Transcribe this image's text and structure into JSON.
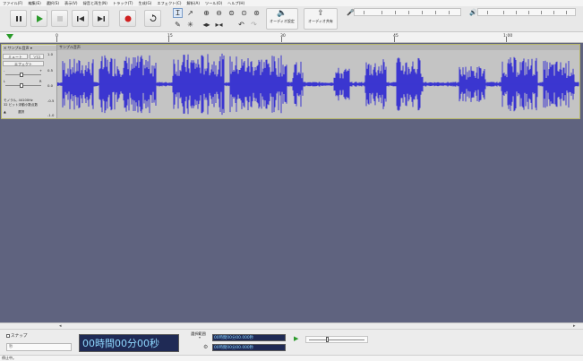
{
  "menu": [
    "ファイル(F)",
    "編集(E)",
    "選択(S)",
    "表示(V)",
    "録音と再生(N)",
    "トラック(T)",
    "生成(G)",
    "エフェクト(C)",
    "解析(A)",
    "ツール(O)",
    "ヘルプ(H)"
  ],
  "transport": {
    "pause_icon": "pause-icon",
    "play_icon": "play-icon",
    "stop_icon": "stop-icon",
    "skip_start_icon": "skip-to-start-icon",
    "skip_end_icon": "skip-to-end-icon",
    "record_icon": "record-icon",
    "loop_icon": "loop-icon",
    "accent_play": "#2a9a2a",
    "accent_record": "#d02020"
  },
  "tools": {
    "audio_setup_label": "オーディオ設定",
    "audio_share_label": "オーディオ共有"
  },
  "meters": {
    "record_ticks": [
      "-54",
      "-48",
      "-42",
      "-36",
      "-30",
      "-24",
      "-18",
      "-12"
    ],
    "play_ticks": [
      "-54",
      "-48",
      "-42",
      "-36",
      "-30",
      "-24",
      "-18",
      "-12"
    ]
  },
  "ruler": {
    "labels": [
      "0",
      "15",
      "30",
      "45",
      "1:00"
    ]
  },
  "track": {
    "name": "サンプル音声",
    "mute_label": "ミュート",
    "solo_label": "ソロ",
    "effect_label": "エフェクト",
    "gain_left": "-",
    "gain_right": "+",
    "pan_left": "L",
    "pan_right": "R",
    "info_line1": "モノラル, 44100Hz",
    "info_line2": "32 ビット浮動小数点数",
    "select_label": "選択",
    "scale_top": "1.0",
    "scale_upper": "0.5",
    "scale_mid": "0.0",
    "scale_lower": "-0.5",
    "scale_bottom": "-1.0",
    "clip_title": "サンプル音声",
    "waveform_color": "#3b36d0",
    "background_color": "#5f637f"
  },
  "selection_toolbar": {
    "snap_label": "スナップ",
    "snap_value": "秒",
    "time_display": "00時間00分00秒",
    "selection_label": "選択範囲",
    "start_time": "00時間00分00.000秒",
    "end_time": "00時間00分00.000秒"
  },
  "status": {
    "text": "停止中。"
  }
}
